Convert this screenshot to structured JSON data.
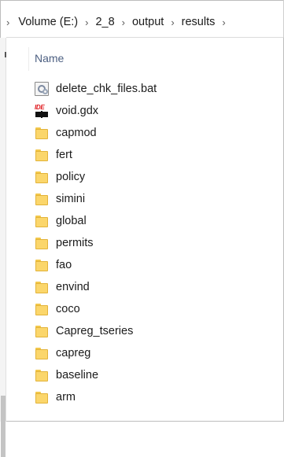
{
  "breadcrumb": [
    "Volume (E:)",
    "2_8",
    "output",
    "results"
  ],
  "columns": {
    "name": "Name"
  },
  "files": [
    {
      "name": "delete_chk_files.bat",
      "icon": "batch-file-icon"
    },
    {
      "name": "void.gdx",
      "icon": "gdx-file-icon"
    },
    {
      "name": "capmod",
      "icon": "folder-icon"
    },
    {
      "name": "fert",
      "icon": "folder-icon"
    },
    {
      "name": "policy",
      "icon": "folder-icon"
    },
    {
      "name": "simini",
      "icon": "folder-icon"
    },
    {
      "name": "global",
      "icon": "folder-icon"
    },
    {
      "name": "permits",
      "icon": "folder-icon"
    },
    {
      "name": "fao",
      "icon": "folder-icon"
    },
    {
      "name": "envind",
      "icon": "folder-icon"
    },
    {
      "name": "coco",
      "icon": "folder-icon"
    },
    {
      "name": "Capreg_tseries",
      "icon": "folder-icon"
    },
    {
      "name": "capreg",
      "icon": "folder-icon"
    },
    {
      "name": "baseline",
      "icon": "folder-icon"
    },
    {
      "name": "arm",
      "icon": "folder-icon"
    }
  ],
  "colors": {
    "folder": "#fbd66b",
    "header_text": "#4d6082"
  }
}
